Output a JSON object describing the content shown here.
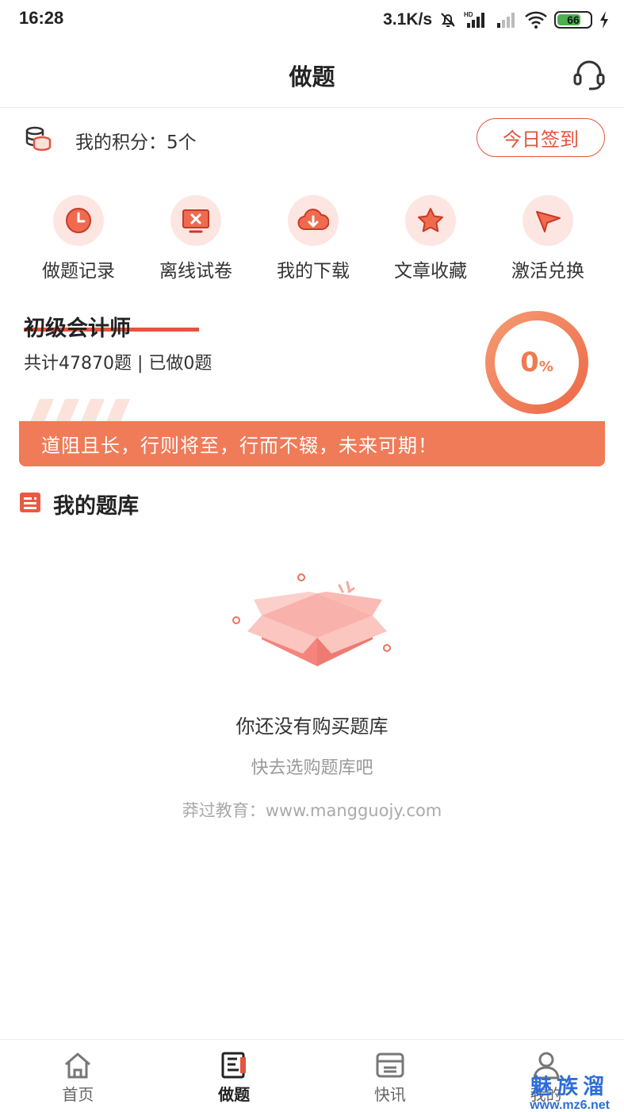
{
  "status_bar": {
    "time": "16:28",
    "net_speed": "3.1K/s",
    "battery": "66"
  },
  "header": {
    "title": "做题",
    "support_icon": "headset-icon"
  },
  "points": {
    "text": "我的积分：5个",
    "icon": "coins-icon",
    "signin_label": "今日签到"
  },
  "quick_menu": [
    {
      "label": "做题记录",
      "icon": "clock-icon"
    },
    {
      "label": "离线试卷",
      "icon": "offline-paper-icon"
    },
    {
      "label": "我的下载",
      "icon": "cloud-download-icon"
    },
    {
      "label": "文章收藏",
      "icon": "star-icon"
    },
    {
      "label": "激活兑换",
      "icon": "paper-plane-icon"
    }
  ],
  "course": {
    "name": "初级会计师",
    "stats": "共计47870题 | 已做0题",
    "progress_value": "0",
    "progress_unit": "%",
    "progress_fraction": 0
  },
  "motto": "道阻且长，行则将至，行而不辍，未来可期！",
  "library": {
    "title": "我的题库",
    "empty_title": "你还没有购买题库",
    "empty_subtitle": "快去选购题库吧",
    "site": "莽过教育：www.mangguojy.com"
  },
  "tabs": [
    {
      "label": "首页",
      "icon": "home-icon",
      "active": false
    },
    {
      "label": "做题",
      "icon": "exercise-icon",
      "active": true
    },
    {
      "label": "快讯",
      "icon": "news-icon",
      "active": false
    },
    {
      "label": "我的",
      "icon": "user-icon",
      "active": false
    }
  ],
  "watermark": {
    "text": "魅族溜",
    "url": "www.mz6.net"
  },
  "colors": {
    "accent": "#e2553e",
    "banner": "#f07b58",
    "icon_bg": "#fde6e1",
    "ring": "#ef7a52",
    "watermark": "#2b6fd8"
  }
}
